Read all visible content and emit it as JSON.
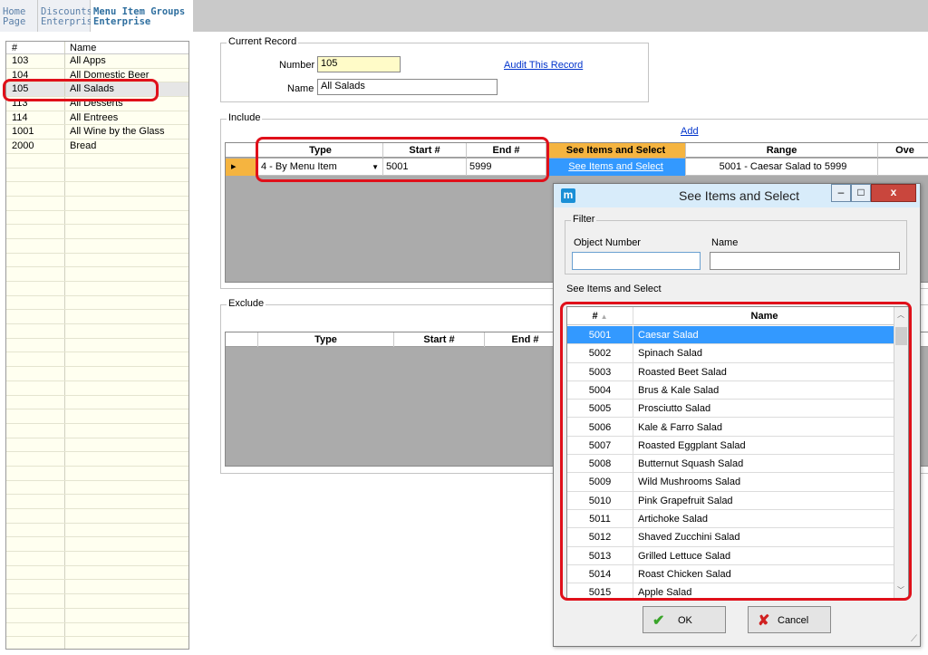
{
  "tabs": [
    {
      "line1": "Home",
      "line2": "Page"
    },
    {
      "line1": "Discounts",
      "line2": "Enterprise"
    },
    {
      "line1": "Menu Item Groups",
      "line2": "Enterprise"
    }
  ],
  "left_list": {
    "headers": {
      "num": "#",
      "name": "Name"
    },
    "rows": [
      {
        "num": "103",
        "name": "All Apps"
      },
      {
        "num": "104",
        "name": "All Domestic Beer"
      },
      {
        "num": "105",
        "name": "All Salads"
      },
      {
        "num": "113",
        "name": "All Desserts"
      },
      {
        "num": "114",
        "name": "All Entrees"
      },
      {
        "num": "1001",
        "name": "All Wine by the Glass"
      },
      {
        "num": "2000",
        "name": "Bread"
      }
    ],
    "selected_index": 2
  },
  "current_record": {
    "legend": "Current Record",
    "number_label": "Number",
    "number_value": "105",
    "audit_link": "Audit This Record",
    "name_label": "Name",
    "name_value": "All Salads"
  },
  "include": {
    "legend": "Include",
    "add_link": "Add",
    "headers": {
      "type": "Type",
      "start": "Start #",
      "end": "End #",
      "see": "See Items and Select",
      "range": "Range",
      "over": "Ove"
    },
    "row": {
      "type": "4 - By Menu Item",
      "start": "5001",
      "end": "5999",
      "see": "See Items and Select",
      "range": "5001 - Caesar Salad to 5999"
    }
  },
  "exclude": {
    "legend": "Exclude",
    "headers": {
      "type": "Type",
      "start": "Start #",
      "end": "End #"
    }
  },
  "dialog": {
    "title": "See Items and Select",
    "filter_legend": "Filter",
    "object_number_label": "Object Number",
    "name_label": "Name",
    "list_label": "See Items and Select",
    "headers": {
      "num": "#",
      "name": "Name"
    },
    "items": [
      {
        "num": "5001",
        "name": "Caesar Salad"
      },
      {
        "num": "5002",
        "name": "Spinach Salad"
      },
      {
        "num": "5003",
        "name": "Roasted Beet Salad"
      },
      {
        "num": "5004",
        "name": "Brus & Kale Salad"
      },
      {
        "num": "5005",
        "name": "Prosciutto Salad"
      },
      {
        "num": "5006",
        "name": "Kale & Farro Salad"
      },
      {
        "num": "5007",
        "name": "Roasted Eggplant Salad"
      },
      {
        "num": "5008",
        "name": "Butternut Squash Salad"
      },
      {
        "num": "5009",
        "name": "Wild Mushrooms Salad"
      },
      {
        "num": "5010",
        "name": "Pink Grapefruit Salad"
      },
      {
        "num": "5011",
        "name": "Artichoke Salad"
      },
      {
        "num": "5012",
        "name": "Shaved Zucchini Salad"
      },
      {
        "num": "5013",
        "name": "Grilled Lettuce Salad"
      },
      {
        "num": "5014",
        "name": "Roast Chicken Salad"
      },
      {
        "num": "5015",
        "name": "Apple Salad"
      }
    ],
    "selected_index": 0,
    "ok_label": "OK",
    "cancel_label": "Cancel"
  },
  "colors": {
    "highlight": "#e0101a",
    "selection": "#3399ff",
    "header_orange": "#f5b440",
    "accent_blue": "#1a8fd6"
  }
}
